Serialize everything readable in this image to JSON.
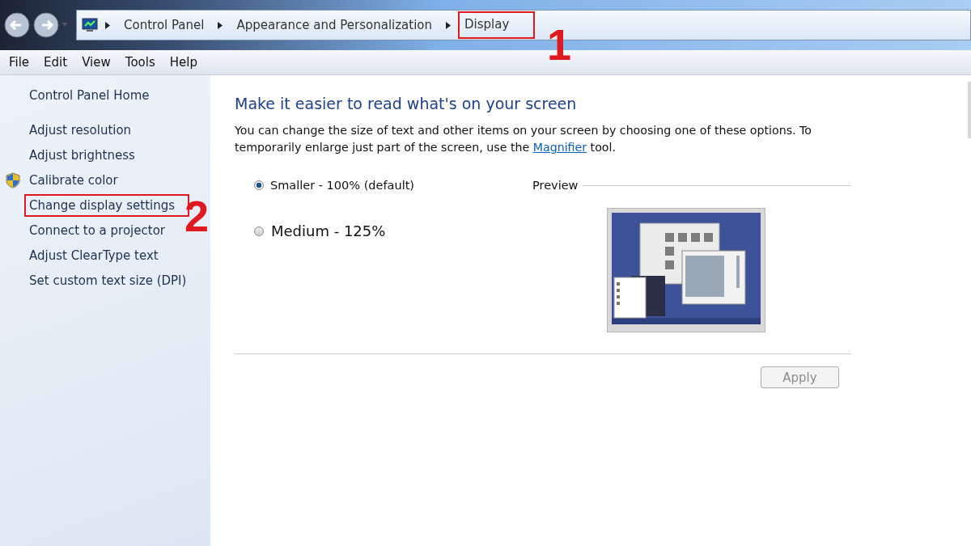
{
  "breadcrumb": [
    {
      "label": "Control Panel",
      "highlighted": false
    },
    {
      "label": "Appearance and Personalization",
      "highlighted": false
    },
    {
      "label": "Display",
      "highlighted": true
    }
  ],
  "menu": [
    "File",
    "Edit",
    "View",
    "Tools",
    "Help"
  ],
  "sidebar": {
    "home": "Control Panel Home",
    "items": [
      {
        "label": "Adjust resolution",
        "shield": false,
        "highlighted": false
      },
      {
        "label": "Adjust brightness",
        "shield": false,
        "highlighted": false
      },
      {
        "label": "Calibrate color",
        "shield": true,
        "highlighted": false
      },
      {
        "label": "Change display settings",
        "shield": false,
        "highlighted": true
      },
      {
        "label": "Connect to a projector",
        "shield": false,
        "highlighted": false
      },
      {
        "label": "Adjust ClearType text",
        "shield": false,
        "highlighted": false
      },
      {
        "label": "Set custom text size (DPI)",
        "shield": false,
        "highlighted": false
      }
    ]
  },
  "content": {
    "heading": "Make it easier to read what's on your screen",
    "intro_before": "You can change the size of text and other items on your screen by choosing one of these options. To temporarily enlarge just part of the screen, use the",
    "intro_link": "Magnifier",
    "intro_after": "tool.",
    "options": [
      {
        "label": "Smaller - 100% (default)",
        "selected": true,
        "kind": "small"
      },
      {
        "label": "Medium - 125%",
        "selected": false,
        "kind": "medium"
      }
    ],
    "preview_label": "Preview",
    "apply": {
      "label": "Apply",
      "disabled": true
    }
  },
  "annotations": [
    "1",
    "2"
  ]
}
